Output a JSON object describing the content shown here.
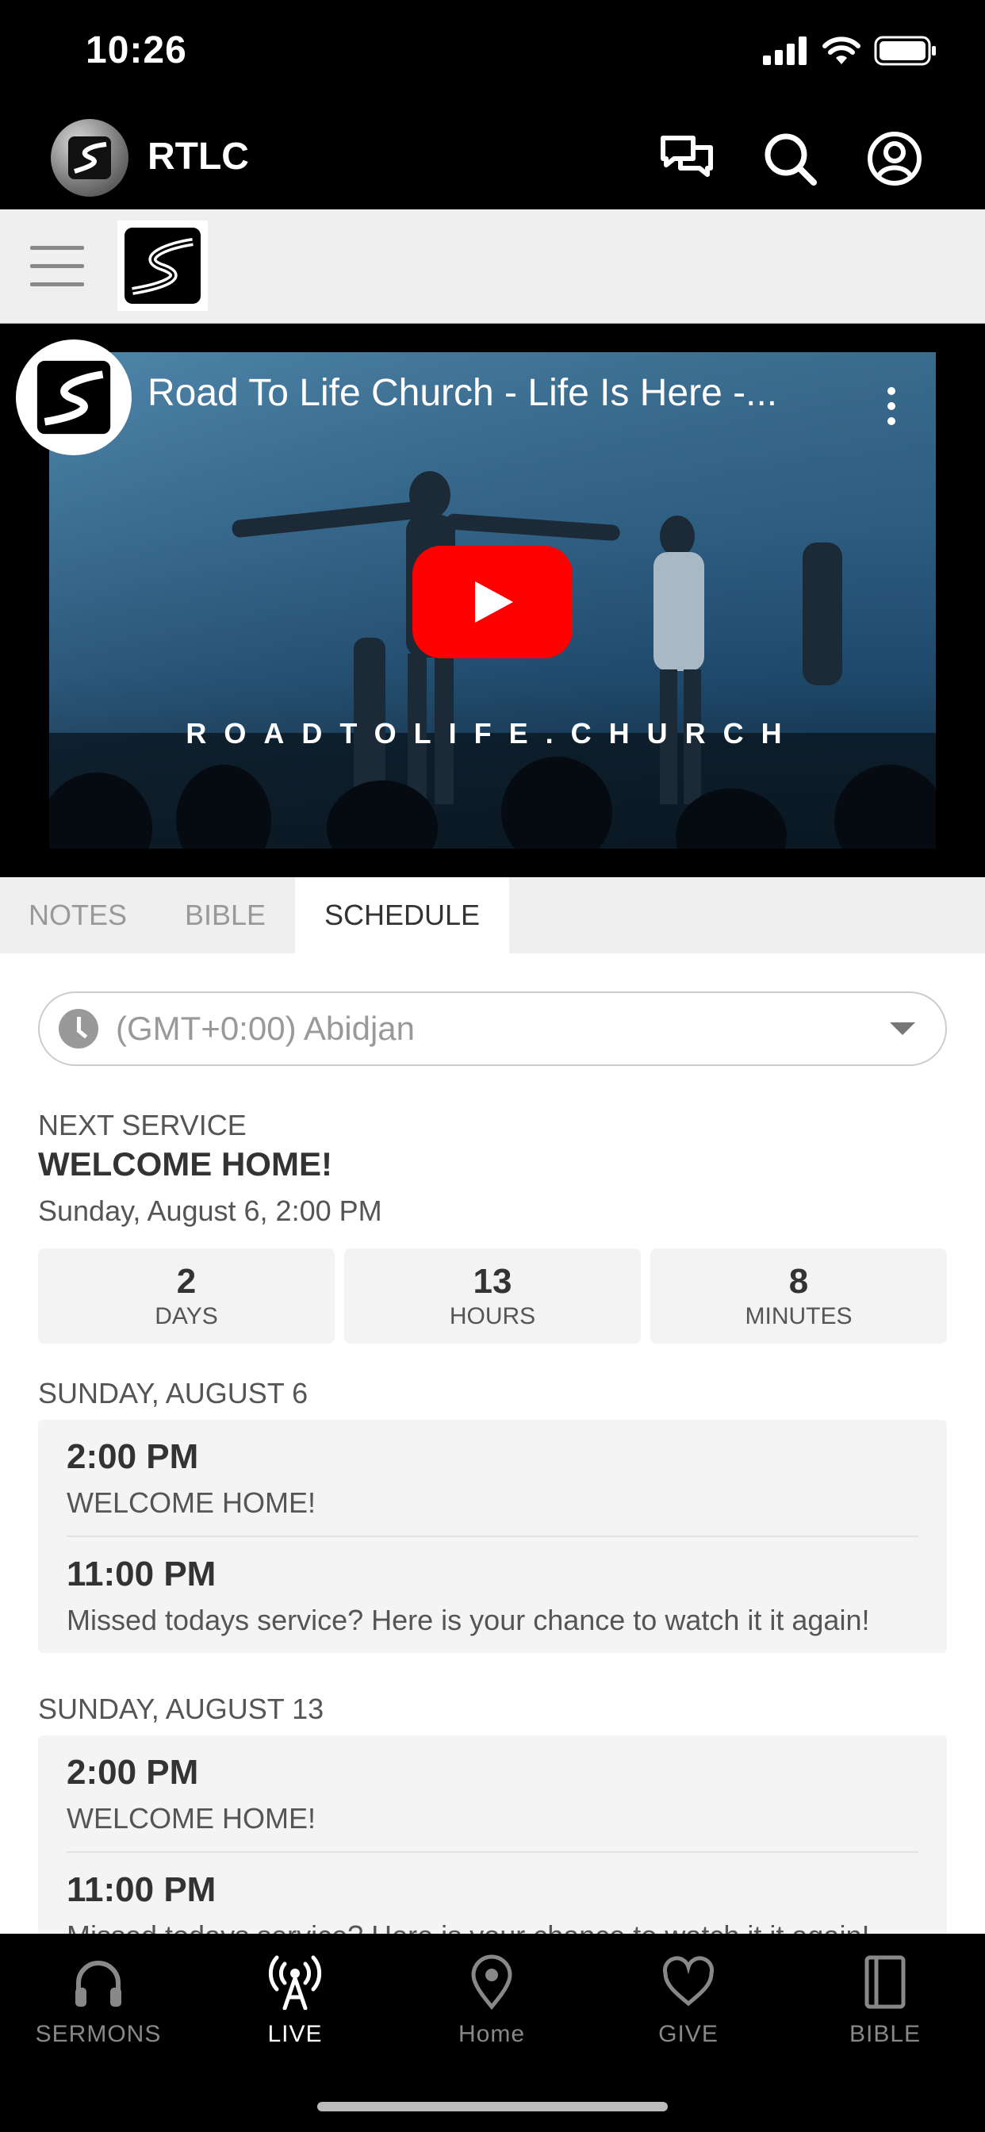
{
  "status_bar": {
    "time": "10:26"
  },
  "app_header": {
    "title": "RTLC"
  },
  "video": {
    "title": "Road To Life Church - Life Is Here -...",
    "watermark": "ROADTOLIFE.CHURCH"
  },
  "tabs": [
    {
      "label": "NOTES"
    },
    {
      "label": "BIBLE"
    },
    {
      "label": "SCHEDULE"
    }
  ],
  "schedule": {
    "timezone": "(GMT+0:00) Abidjan",
    "next_service_label": "NEXT SERVICE",
    "next_service_title": "WELCOME HOME!",
    "next_service_date": "Sunday, August 6, 2:00 PM",
    "countdown": [
      {
        "value": "2",
        "unit": "DAYS"
      },
      {
        "value": "13",
        "unit": "HOURS"
      },
      {
        "value": "8",
        "unit": "MINUTES"
      }
    ],
    "days": [
      {
        "heading": "SUNDAY, AUGUST 6",
        "events": [
          {
            "time": "2:00 PM",
            "title": "WELCOME HOME!"
          },
          {
            "time": "11:00 PM",
            "title": "Missed todays service? Here is your chance to watch it it again!"
          }
        ]
      },
      {
        "heading": "SUNDAY, AUGUST 13",
        "events": [
          {
            "time": "2:00 PM",
            "title": "WELCOME HOME!"
          },
          {
            "time": "11:00 PM",
            "title": "Missed todays service? Here is your chance to watch it it again!"
          }
        ]
      }
    ]
  },
  "tab_bar": [
    {
      "label": "SERMONS",
      "icon": "headphones-icon"
    },
    {
      "label": "LIVE",
      "icon": "broadcast-icon"
    },
    {
      "label": "Home",
      "icon": "location-pin-icon"
    },
    {
      "label": "GIVE",
      "icon": "heart-icon"
    },
    {
      "label": "BIBLE",
      "icon": "book-icon"
    }
  ]
}
